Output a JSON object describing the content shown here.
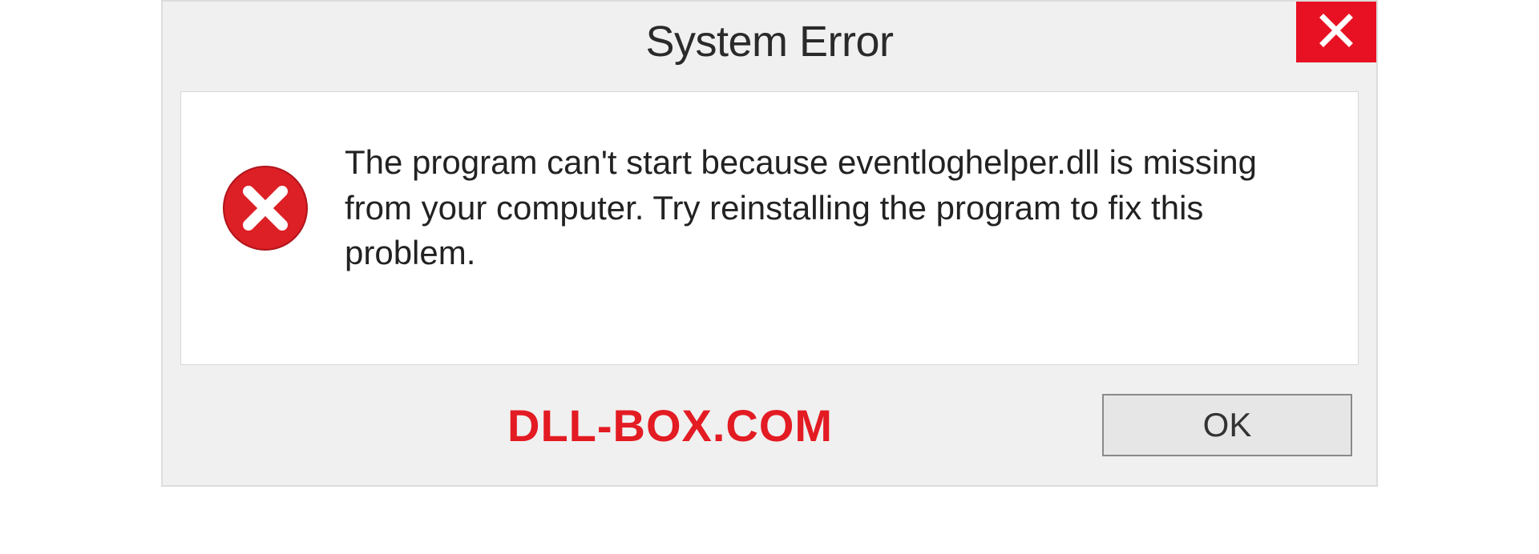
{
  "dialog": {
    "title": "System Error",
    "message": "The program can't start because eventloghelper.dll is missing from your computer. Try reinstalling the program to fix this problem.",
    "ok_label": "OK"
  },
  "watermark": "DLL-BOX.COM",
  "colors": {
    "close_bg": "#e81123",
    "error_icon": "#dd1f26",
    "watermark": "#e31b23"
  }
}
